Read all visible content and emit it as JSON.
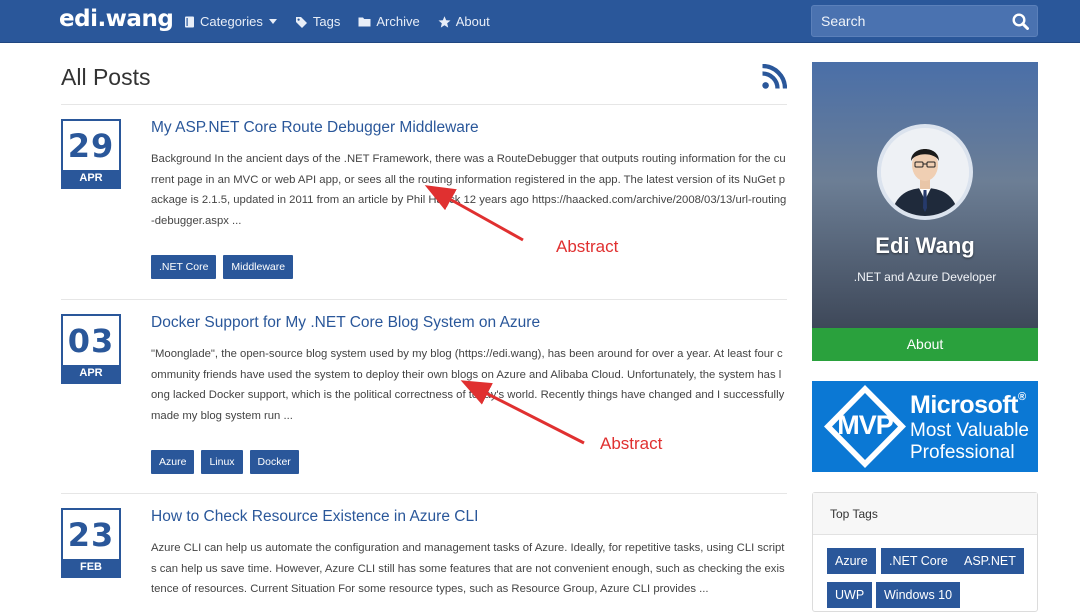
{
  "nav": {
    "brand": "edi.wang",
    "items": [
      {
        "label": "Categories",
        "icon": "book-icon"
      },
      {
        "label": "Tags",
        "icon": "tag-icon"
      },
      {
        "label": "Archive",
        "icon": "folder-icon"
      },
      {
        "label": "About",
        "icon": "star-icon"
      }
    ],
    "search_placeholder": "Search"
  },
  "main": {
    "title": "All Posts",
    "posts": [
      {
        "day": "29",
        "month": "APR",
        "title": "My ASP.NET Core Route Debugger Middleware",
        "abstract": "Background In the ancient days of the .NET Framework, there was a RouteDebugger that outputs routing information for the current page in an MVC or web API app, or sees all the routing information registered in the app. The latest version of its NuGet package is 2.1.5, updated in 2011 from an article by Phil Haack 12 years ago https://haacked.com/archive/2008/03/13/url-routing-debugger.aspx ...",
        "tags": [
          ".NET Core",
          "Middleware"
        ]
      },
      {
        "day": "03",
        "month": "APR",
        "title": "Docker Support for My .NET Core Blog System on Azure",
        "abstract": "\"Moonglade\", the open-source blog system used by my blog (https://edi.wang), has been around for over a year. At least four community friends have used the system to deploy their own blogs on Azure and Alibaba Cloud. Unfortunately, the system has long lacked Docker support, which is the political correctness of today's world. Recently things have changed and I successfully made my blog system run ...",
        "tags": [
          "Azure",
          "Linux",
          "Docker"
        ]
      },
      {
        "day": "23",
        "month": "FEB",
        "title": "How to Check Resource Existence in Azure CLI",
        "abstract": "Azure CLI can help us automate the configuration and management tasks of Azure. Ideally, for repetitive tasks, using CLI scripts can help us save time. However, Azure CLI still has some features that are not convenient enough, such as checking the existence of resources. Current Situation For some resource types, such as Resource Group, Azure CLI provides ...",
        "tags": []
      }
    ],
    "annotations": [
      "Abstract",
      "Abstract"
    ]
  },
  "sidebar": {
    "name": "Edi Wang",
    "role": ".NET and Azure Developer",
    "about_label": "About",
    "mvp": {
      "line1": "Microsoft",
      "reg": "®",
      "line2": "Most Valuable",
      "line3": "Professional",
      "badge": "MVP"
    },
    "top_tags_title": "Top Tags",
    "top_tags": [
      "Azure",
      ".NET Core",
      "ASP.NET",
      "UWP",
      "Windows 10"
    ]
  },
  "colors": {
    "primary": "#2a579a",
    "about_green": "#2aa13d",
    "mvp_blue": "#0b78d4",
    "annotation_red": "#e03030"
  }
}
